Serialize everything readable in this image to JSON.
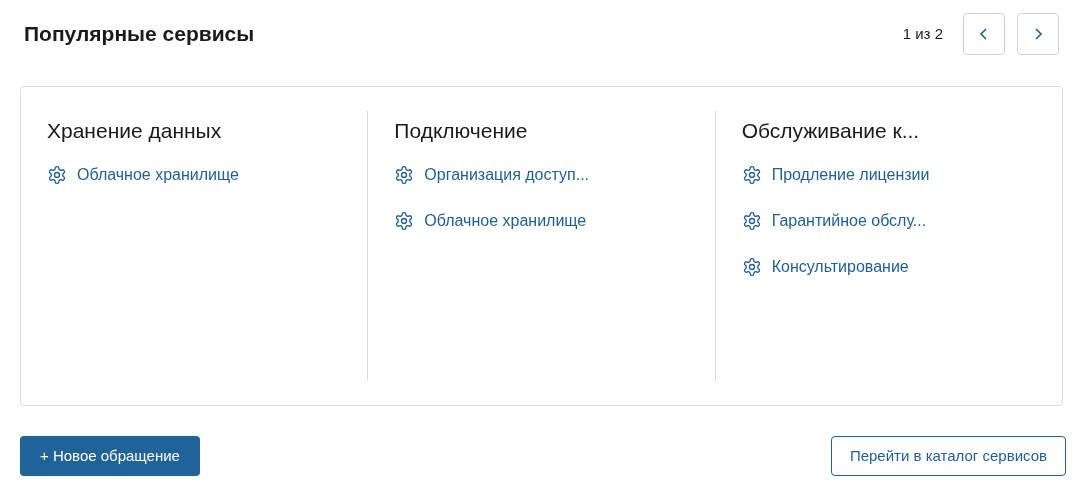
{
  "title": "Популярные сервисы",
  "pager": {
    "text": "1 из 2"
  },
  "categories": [
    {
      "title": "Хранение данных",
      "services": [
        "Облачное хранилище"
      ]
    },
    {
      "title": "Подключение",
      "services": [
        "Организация доступ...",
        "Облачное хранилище"
      ]
    },
    {
      "title": "Обслуживание к...",
      "services": [
        "Продление лицензии",
        "Гарантийное обслу...",
        "Консультирование"
      ]
    }
  ],
  "buttons": {
    "primary": "+ Новое обращение",
    "secondary": "Перейти в каталог сервисов"
  }
}
